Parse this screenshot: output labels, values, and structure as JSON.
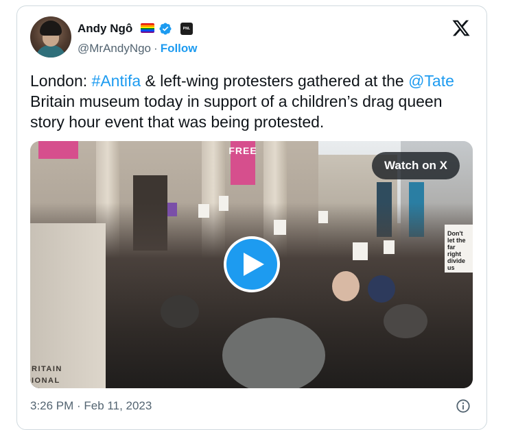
{
  "author": {
    "name": "Andy Ngô",
    "handle": "@MrAndyNgo",
    "separator": "·",
    "follow_label": "Follow",
    "affiliate_badge_text": "PNL",
    "flag_colors": [
      "#e40303",
      "#ff8c00",
      "#ffed00",
      "#008026",
      "#004dff",
      "#750787"
    ]
  },
  "tweet": {
    "text_part1": "London: ",
    "hashtag": "#Antifa",
    "text_part2": " & left-wing protesters gathered at the ",
    "mention": "@Tate",
    "text_part3": " Britain museum today in support of a children’s drag queen story hour event that was being protested."
  },
  "media": {
    "watch_label": "Watch on X",
    "banner_text": "FREE",
    "plinth_text": "RITAIN\nIONAL\nON OF\nART",
    "sign_text": "Don't let the far right divide us"
  },
  "meta": {
    "timestamp": "3:26 PM · Feb 11, 2023"
  },
  "icons": {
    "brand": "x-logo-icon",
    "verified": "verified-badge-icon",
    "info": "info-icon",
    "play": "play-icon"
  },
  "colors": {
    "link": "#1d9bf0",
    "secondary_text": "#536471",
    "primary_text": "#0f1419",
    "border": "#cfd9de"
  }
}
